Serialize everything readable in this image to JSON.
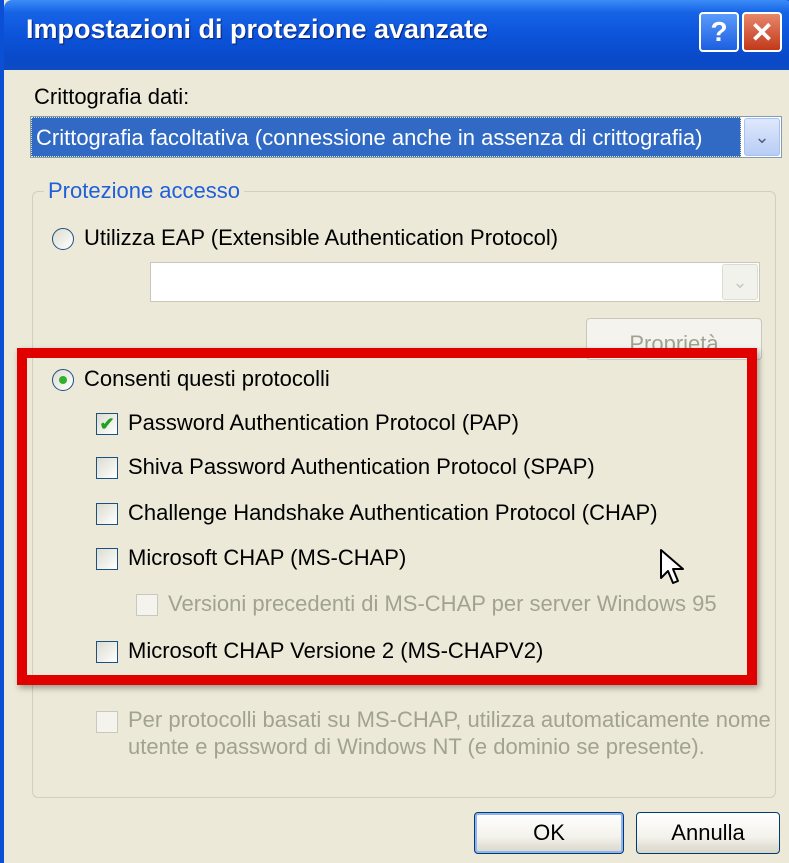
{
  "window": {
    "title": "Impostazioni di protezione avanzate",
    "help_button": "?",
    "close_button": "✕"
  },
  "encryption": {
    "label": "Crittografia dati:",
    "selected_value": "Crittografia facoltativa (connessione anche in assenza di crittografia)"
  },
  "access_protection": {
    "legend": "Protezione accesso",
    "eap_option": "Utilizza EAP (Extensible Authentication Protocol)",
    "eap_combo_value": "",
    "properties_button": "Proprietà",
    "allow_protocols_option": "Consenti questi protocolli",
    "protocols": [
      {
        "label": "Password Authentication Protocol (PAP)",
        "checked": true
      },
      {
        "label": "Shiva Password Authentication Protocol (SPAP)",
        "checked": false
      },
      {
        "label": "Challenge Handshake Authentication Protocol (CHAP)",
        "checked": false
      },
      {
        "label": "Microsoft CHAP (MS-CHAP)",
        "checked": false
      },
      {
        "label": "Versioni precedenti di MS-CHAP per server Windows 95",
        "checked": false
      },
      {
        "label": "Microsoft CHAP Versione 2 (MS-CHAPV2)",
        "checked": false
      }
    ],
    "auto_credentials_line1": "Per protocolli basati su MS-CHAP, utilizza automaticamente nome",
    "auto_credentials_line2": "utente e password di Windows NT (e dominio se presente)."
  },
  "buttons": {
    "ok": "OK",
    "cancel": "Annulla"
  },
  "icons": {
    "check_glyph": "✔",
    "dropdown_glyph": "⌄"
  },
  "colors": {
    "titlebar": "#0b52d8",
    "highlight_frame": "#e00000",
    "selection": "#316ac5"
  }
}
